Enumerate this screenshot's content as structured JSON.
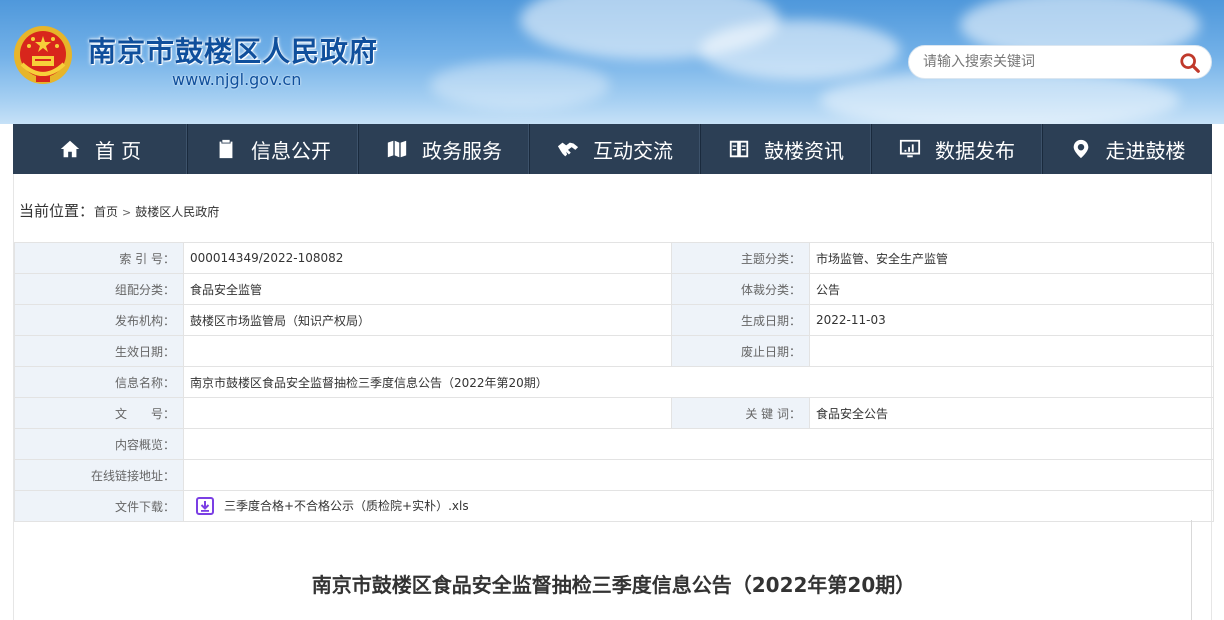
{
  "header": {
    "site_title": "南京市鼓楼区人民政府",
    "site_url": "www.njgl.gov.cn",
    "search": {
      "placeholder": "请输入搜索关键词"
    }
  },
  "nav": {
    "items": [
      {
        "label": "首 页",
        "icon": "home-icon"
      },
      {
        "label": "信息公开",
        "icon": "clipboard-icon"
      },
      {
        "label": "政务服务",
        "icon": "map-icon"
      },
      {
        "label": "互动交流",
        "icon": "handshake-icon"
      },
      {
        "label": "鼓楼资讯",
        "icon": "book-icon"
      },
      {
        "label": "数据发布",
        "icon": "monitor-chart-icon"
      },
      {
        "label": "走进鼓楼",
        "icon": "location-pin-icon"
      }
    ]
  },
  "breadcrumb": {
    "prefix": "当前位置：",
    "home": "首页",
    "separator": ">",
    "current": "鼓楼区人民政府"
  },
  "meta": {
    "index_label": "索 引 号：",
    "index_value": "000014349/2022-108082",
    "topic_label": "主题分类：",
    "topic_value": "市场监管、安全生产监管",
    "category_label": "组配分类：",
    "category_value": "食品安全监管",
    "genre_label": "体裁分类：",
    "genre_value": "公告",
    "publisher_label": "发布机构：",
    "publisher_value": "鼓楼区市场监管局（知识产权局）",
    "created_label": "生成日期：",
    "created_value": "2022-11-03",
    "effective_label": "生效日期：",
    "effective_value": "",
    "expired_label": "废止日期：",
    "expired_value": "",
    "name_label": "信息名称：",
    "name_value": "南京市鼓楼区食品安全监督抽检三季度信息公告（2022年第20期）",
    "docno_label": "文　　号：",
    "docno_value": "",
    "keywords_label": "关 键 词：",
    "keywords_value": "食品安全公告",
    "summary_label": "内容概览：",
    "summary_value": "",
    "link_label": "在线链接地址：",
    "link_value": "",
    "download_label": "文件下载：",
    "download_file": "三季度合格+不合格公示（质检院+实朴）.xls"
  },
  "article": {
    "title": "南京市鼓楼区食品安全监督抽检三季度信息公告（2022年第20期）"
  },
  "colors": {
    "nav_bg": "#2c3f55",
    "title_blue": "#0f4f9c",
    "label_bg": "#eef3f9",
    "download_icon": "#7b3fe4",
    "search_icon": "#c0392b"
  }
}
